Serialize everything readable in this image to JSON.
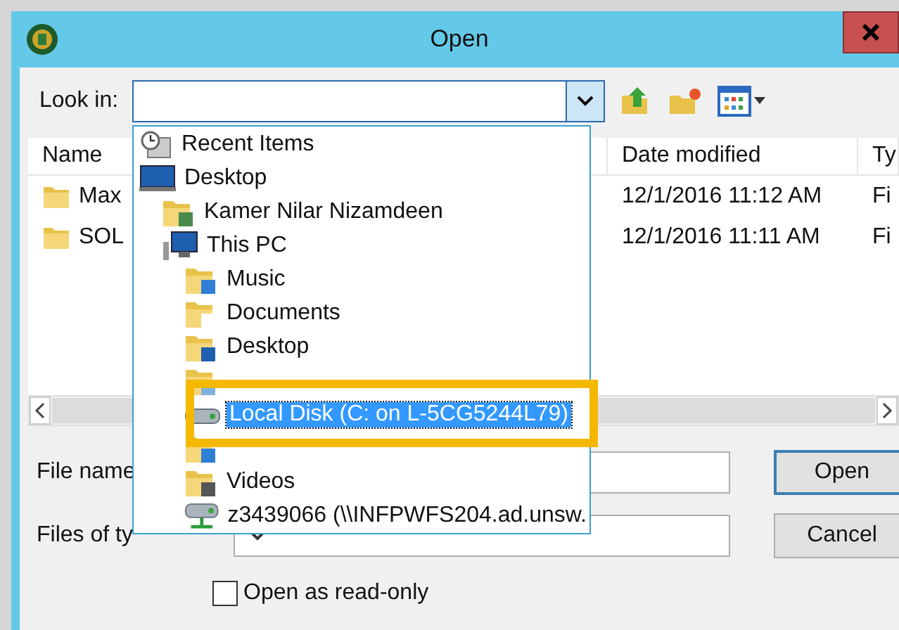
{
  "window": {
    "title": "Open"
  },
  "look_in": {
    "label": "Look in:"
  },
  "file_list": {
    "columns": [
      "Name",
      "Date modified",
      "Ty"
    ],
    "rows": [
      {
        "name": "Max",
        "date": "12/1/2016 11:12 AM",
        "type": "Fi"
      },
      {
        "name": "SOL",
        "date": "12/1/2016 11:11 AM",
        "type": "Fi"
      }
    ]
  },
  "location_dropdown": {
    "items": [
      {
        "label": "Recent Items",
        "kind": "recent",
        "selected": false
      },
      {
        "label": "Desktop",
        "kind": "desktop",
        "selected": false,
        "children": [
          {
            "label": "Kamer Nilar Nizamdeen",
            "kind": "user",
            "selected": false
          },
          {
            "label": "This PC",
            "kind": "pc",
            "selected": false,
            "children": [
              {
                "label": "Music",
                "kind": "music",
                "selected": false
              },
              {
                "label": "Documents",
                "kind": "documents",
                "selected": false
              },
              {
                "label": "Desktop",
                "kind": "desktop-folder",
                "selected": false
              },
              {
                "kind": "pictures"
              },
              {
                "label": "Local Disk (C: on L-5CG5244L79)",
                "kind": "drive",
                "selected": true
              },
              {
                "kind": "downloads"
              },
              {
                "label": "Videos",
                "kind": "videos",
                "selected": false
              },
              {
                "label": "z3439066 (\\\\INFPWFS204.ad.unsw.",
                "kind": "network",
                "selected": false
              }
            ]
          }
        ]
      }
    ]
  },
  "file_name": {
    "label": "File name"
  },
  "file_type": {
    "label": "Files of ty"
  },
  "buttons": [
    {
      "label": "Open",
      "default": true
    },
    {
      "label": "Cancel",
      "default": false
    }
  ],
  "read_only": {
    "label": "Open as read-only",
    "checked": false
  }
}
